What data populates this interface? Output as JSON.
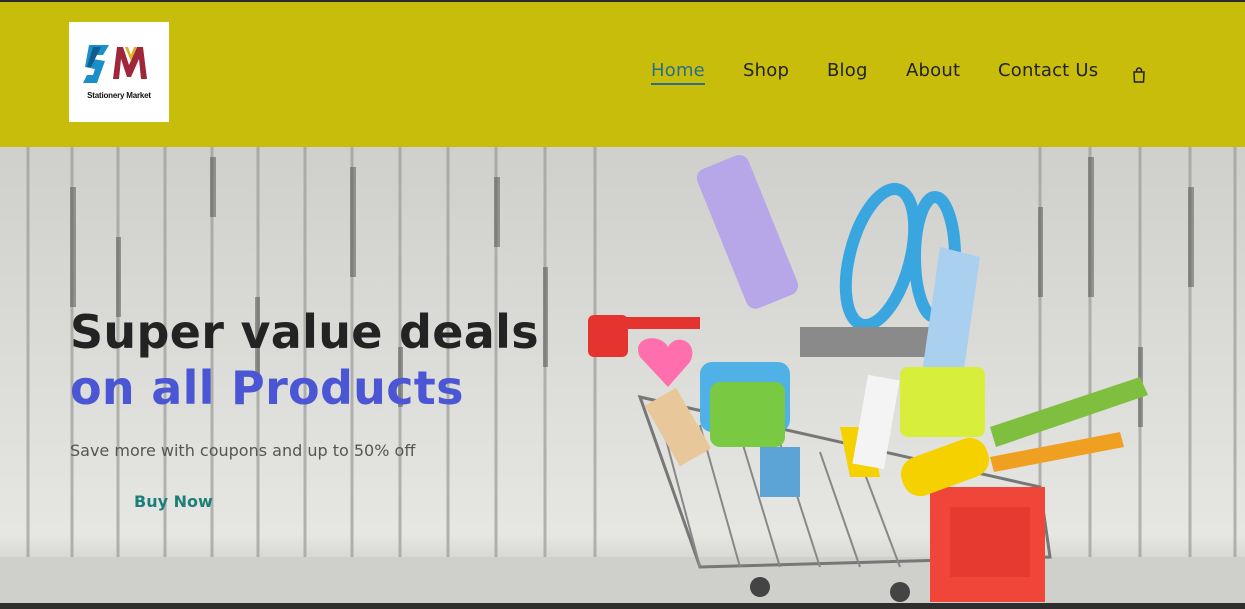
{
  "brand": {
    "logo_text": "Stationery Market",
    "logo_letters": "SM",
    "colors": {
      "header_bg": "#c8bd0b",
      "logo_s": "#1a8fc9",
      "logo_m": "#a0263a",
      "accent_blue": "#4a56d4",
      "link_teal": "#1d7f78"
    }
  },
  "nav": {
    "items": [
      {
        "label": "Home",
        "active": true
      },
      {
        "label": "Shop",
        "active": false
      },
      {
        "label": "Blog",
        "active": false
      },
      {
        "label": "About",
        "active": false
      },
      {
        "label": "Contact Us",
        "active": false
      }
    ],
    "cart_icon": "shopping-bag-icon"
  },
  "hero": {
    "title_line1": "Super value deals",
    "title_line2": "on all Products",
    "subtitle": "Save more with coupons and up to 50% off",
    "cta_label": "Buy Now",
    "image_desc_icon": "shopping-cart-with-stationery"
  }
}
